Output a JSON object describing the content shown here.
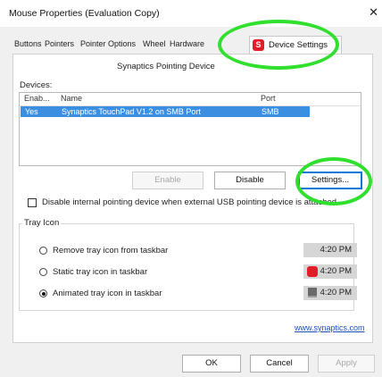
{
  "window": {
    "title": "Mouse Properties (Evaluation Copy)",
    "close_glyph": "✕"
  },
  "tabs": [
    {
      "label": "Buttons"
    },
    {
      "label": "Pointers"
    },
    {
      "label": "Pointer Options"
    },
    {
      "label": "Wheel"
    },
    {
      "label": "Hardware"
    },
    {
      "label": "Device Settings",
      "active": true,
      "icon": "synaptics-icon"
    }
  ],
  "panel": {
    "heading": "Synaptics Pointing Device",
    "devices_label": "Devices:",
    "columns": {
      "enabled": "Enab...",
      "name": "Name",
      "port": "Port"
    },
    "devices": [
      {
        "enabled": "Yes",
        "name": "Synaptics TouchPad V1.2 on SMB Port",
        "port": "SMB",
        "selected": true
      }
    ],
    "buttons": {
      "enable": "Enable",
      "disable": "Disable",
      "settings": "Settings..."
    },
    "checkbox_label": "Disable internal pointing device when external USB pointing device is attached",
    "checkbox_checked": false
  },
  "tray": {
    "title": "Tray Icon",
    "options": [
      {
        "label": "Remove tray icon from taskbar",
        "checked": false,
        "time": "4:20 PM",
        "icon": ""
      },
      {
        "label": "Static tray icon in taskbar",
        "checked": false,
        "time": "4:20 PM",
        "icon": "synaptics-red-icon"
      },
      {
        "label": "Animated tray icon in taskbar",
        "checked": true,
        "time": "4:20 PM",
        "icon": "touchpad-gray-icon"
      }
    ]
  },
  "link": "www.synaptics.com",
  "footer": {
    "ok": "OK",
    "cancel": "Cancel",
    "apply": "Apply"
  },
  "colors": {
    "highlight": "#31e02e",
    "selection": "#3c8fe0",
    "synaptics_red": "#e11d2a"
  }
}
